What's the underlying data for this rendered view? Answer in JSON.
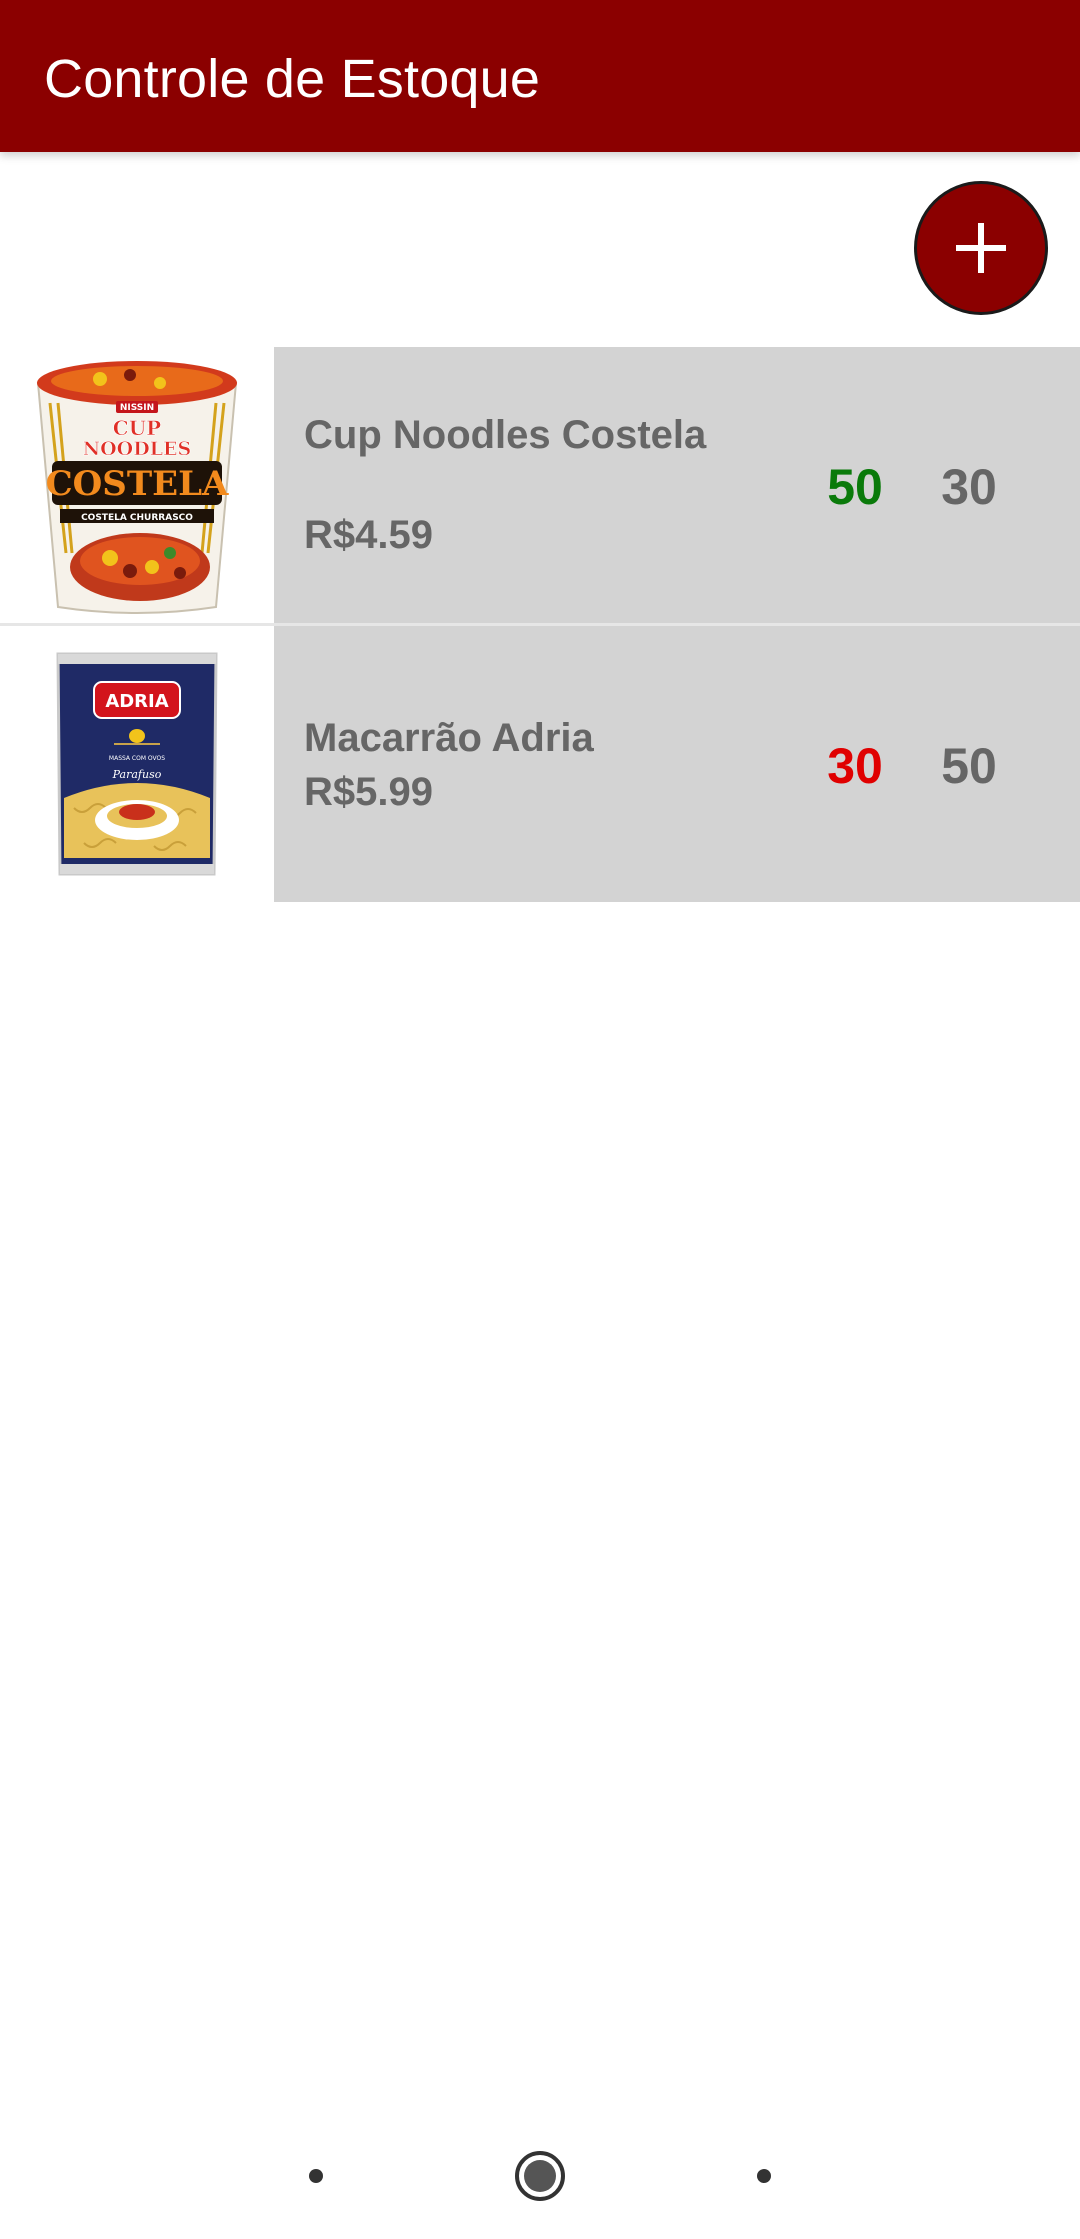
{
  "app_bar": {
    "title": "Controle de Estoque",
    "color": "#8b0000"
  },
  "fab": {
    "icon": "plus-icon"
  },
  "products": [
    {
      "name": "Cup Noodles Costela",
      "price": "R$4.59",
      "quantity": "50",
      "minimum": "30",
      "quantity_color": "#0a7a0a",
      "image": "cup-noodles-costela-image",
      "image_text": {
        "brand": "NISSIN",
        "line": "CUP NOODLES",
        "flavor": "COSTELA",
        "sub": "COSTELA CHURRASCO"
      }
    },
    {
      "name": "Macarrão Adria",
      "price": "R$5.99",
      "quantity": "30",
      "minimum": "50",
      "quantity_color": "#e00000",
      "image": "macarrao-adria-image",
      "image_text": {
        "brand": "ADRIA",
        "sub": "MASSA COM OVOS",
        "type": "Parafuso"
      }
    }
  ],
  "nav": {
    "back_icon": "back-dot-icon",
    "home_icon": "home-icon",
    "recents_icon": "recents-dot-icon"
  }
}
